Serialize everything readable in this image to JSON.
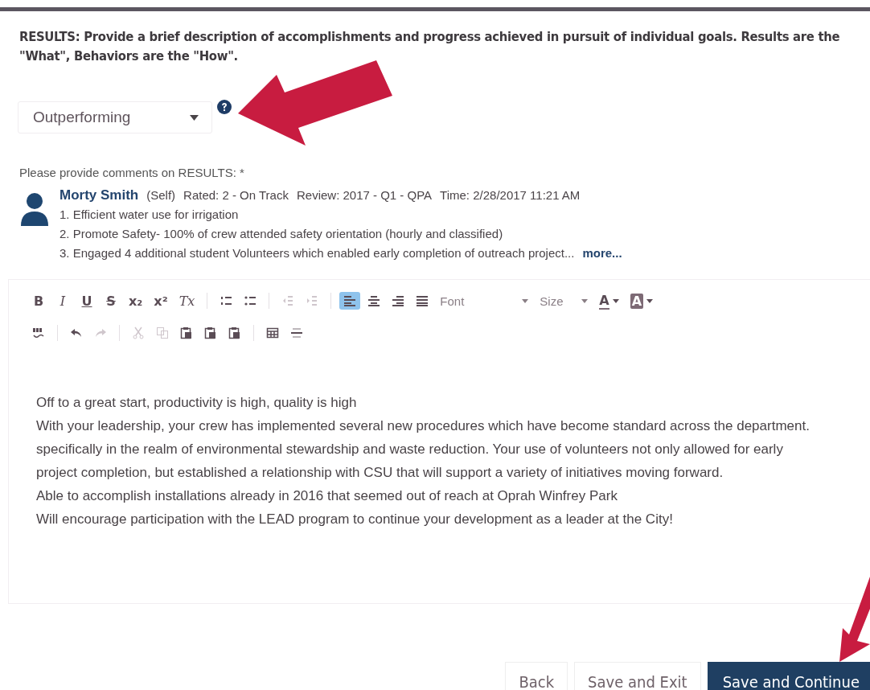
{
  "instructions": "RESULTS: Provide a brief description of accomplishments and progress achieved in pursuit of individual goals. Results are the \"What\", Behaviors are the \"How\".",
  "rating": {
    "value": "Outperforming"
  },
  "comments_label": "Please provide comments on RESULTS: *",
  "prior_comment": {
    "author": "Morty Smith",
    "role": "(Self)",
    "rated": "Rated: 2 - On Track",
    "review": "Review: 2017 - Q1 - QPA",
    "time": "Time: 2/28/2017 11:21 AM",
    "lines": [
      "1. Efficient water use for irrigation",
      "2. Promote Safety- 100% of crew attended safety orientation (hourly and classified)",
      "3. Engaged 4 additional student Volunteers which enabled early completion of outreach project..."
    ],
    "more": "more..."
  },
  "toolbar_rows": [
    [
      {
        "kind": "glyph",
        "label": "B",
        "disabled": false,
        "selected": false
      },
      {
        "kind": "glyph",
        "label": "I",
        "disabled": false,
        "selected": false
      },
      {
        "kind": "glyph",
        "label": "U",
        "disabled": false,
        "selected": false
      },
      {
        "kind": "glyph",
        "label": "S",
        "disabled": false,
        "selected": false
      },
      {
        "kind": "glyph",
        "label": "x₂",
        "disabled": false,
        "selected": false
      },
      {
        "kind": "glyph",
        "label": "x²",
        "disabled": false,
        "selected": false
      },
      {
        "kind": "glyph",
        "label": "Tx",
        "disabled": false,
        "selected": false
      },
      {
        "kind": "separator"
      },
      {
        "kind": "icon",
        "disabled": false,
        "selected": false
      },
      {
        "kind": "icon",
        "disabled": false,
        "selected": false
      },
      {
        "kind": "separator"
      },
      {
        "kind": "icon",
        "disabled": true,
        "selected": false
      },
      {
        "kind": "icon",
        "disabled": true,
        "selected": false
      },
      {
        "kind": "separator"
      },
      {
        "kind": "icon",
        "disabled": false,
        "selected": true
      },
      {
        "kind": "icon",
        "disabled": false,
        "selected": false
      },
      {
        "kind": "icon",
        "disabled": false,
        "selected": false
      },
      {
        "kind": "icon",
        "disabled": false,
        "selected": false
      },
      {
        "kind": "dropdown",
        "label": "Font",
        "disabled": false,
        "selected": false
      },
      {
        "kind": "dropdown",
        "label": "Size",
        "disabled": false,
        "selected": false
      },
      {
        "kind": "color",
        "label": "A",
        "disabled": false,
        "selected": false
      },
      {
        "kind": "color",
        "label": "A",
        "disabled": false,
        "selected": false
      }
    ],
    [
      {
        "kind": "icon",
        "disabled": false
      },
      {
        "kind": "separator"
      },
      {
        "kind": "icon",
        "disabled": false
      },
      {
        "kind": "icon",
        "disabled": true
      },
      {
        "kind": "separator"
      },
      {
        "kind": "icon",
        "disabled": true
      },
      {
        "kind": "icon",
        "disabled": true
      },
      {
        "kind": "icon",
        "disabled": false
      },
      {
        "kind": "icon",
        "disabled": false
      },
      {
        "kind": "icon",
        "disabled": false
      },
      {
        "kind": "separator"
      },
      {
        "kind": "icon",
        "disabled": false
      },
      {
        "kind": "icon",
        "disabled": false
      }
    ]
  ],
  "editor_lines": [
    "Off to a great start, productivity is high, quality is high",
    "With your leadership, your crew has implemented several new procedures which have become standard across the department.",
    "specifically in the realm of environmental stewardship and waste reduction.  Your use of volunteers not only allowed for early project completion, but established a relationship with CSU that will support a variety of initiatives moving forward.",
    "Able to accomplish installations already in 2016 that seemed out of reach at Oprah Winfrey Park",
    "Will encourage participation with the LEAD program to continue your development as a leader at the City!"
  ],
  "buttons": [
    {
      "label": "Back",
      "kind": "secondary"
    },
    {
      "label": "Save and Exit",
      "kind": "secondary"
    },
    {
      "label": "Save and Continue",
      "kind": "primary"
    }
  ]
}
